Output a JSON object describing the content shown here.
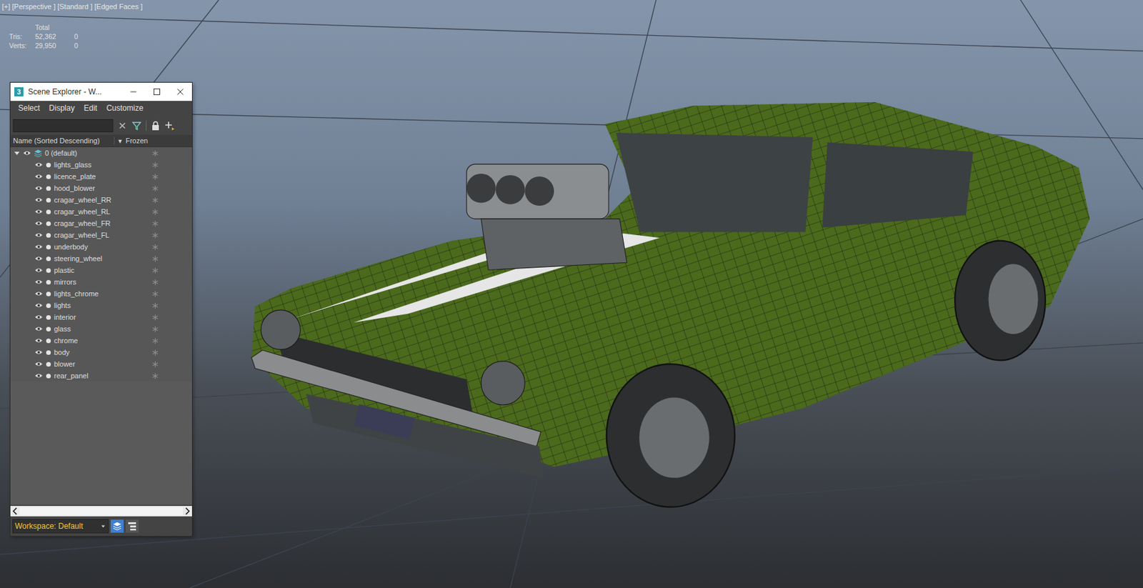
{
  "viewport": {
    "labels": [
      "[+]",
      "[Perspective ]",
      "[Standard ]",
      "[Edged Faces ]"
    ]
  },
  "stats": {
    "header": "Total",
    "rows": [
      {
        "label": "Tris:",
        "total": "52,362",
        "selected": "0"
      },
      {
        "label": "Verts:",
        "total": "29,950",
        "selected": "0"
      }
    ]
  },
  "explorer": {
    "app_badge": "3",
    "title": "Scene Explorer - W...",
    "menu": [
      "Select",
      "Display",
      "Edit",
      "Customize"
    ],
    "search": {
      "value": ""
    },
    "columns": [
      {
        "label": "Name (Sorted Descending)",
        "arrow": "▼"
      },
      {
        "label": "Frozen"
      }
    ],
    "root": {
      "name": "0 (default)",
      "expanded": true,
      "visible": true
    },
    "items": [
      {
        "name": "lights_glass",
        "visible": true,
        "frozen": false
      },
      {
        "name": "licence_plate",
        "visible": true,
        "frozen": false
      },
      {
        "name": "hood_blower",
        "visible": true,
        "frozen": false
      },
      {
        "name": "cragar_wheel_RR",
        "visible": true,
        "frozen": false
      },
      {
        "name": "cragar_wheel_RL",
        "visible": true,
        "frozen": false
      },
      {
        "name": "cragar_wheel_FR",
        "visible": true,
        "frozen": false
      },
      {
        "name": "cragar_wheel_FL",
        "visible": true,
        "frozen": false
      },
      {
        "name": "underbody",
        "visible": true,
        "frozen": false
      },
      {
        "name": "steering_wheel",
        "visible": true,
        "frozen": false
      },
      {
        "name": "plastic",
        "visible": true,
        "frozen": false
      },
      {
        "name": "mirrors",
        "visible": true,
        "frozen": false
      },
      {
        "name": "lights_chrome",
        "visible": true,
        "frozen": false
      },
      {
        "name": "lights",
        "visible": true,
        "frozen": false
      },
      {
        "name": "interior",
        "visible": true,
        "frozen": false
      },
      {
        "name": "glass",
        "visible": true,
        "frozen": false
      },
      {
        "name": "chrome",
        "visible": true,
        "frozen": false
      },
      {
        "name": "body",
        "visible": true,
        "frozen": false
      },
      {
        "name": "blower",
        "visible": true,
        "frozen": false
      },
      {
        "name": "rear_panel",
        "visible": true,
        "frozen": false
      }
    ],
    "workspace": "Workspace: Default",
    "view_buttons": [
      {
        "kind": "layers",
        "selected": true
      },
      {
        "kind": "hierarchy",
        "selected": false
      }
    ]
  }
}
